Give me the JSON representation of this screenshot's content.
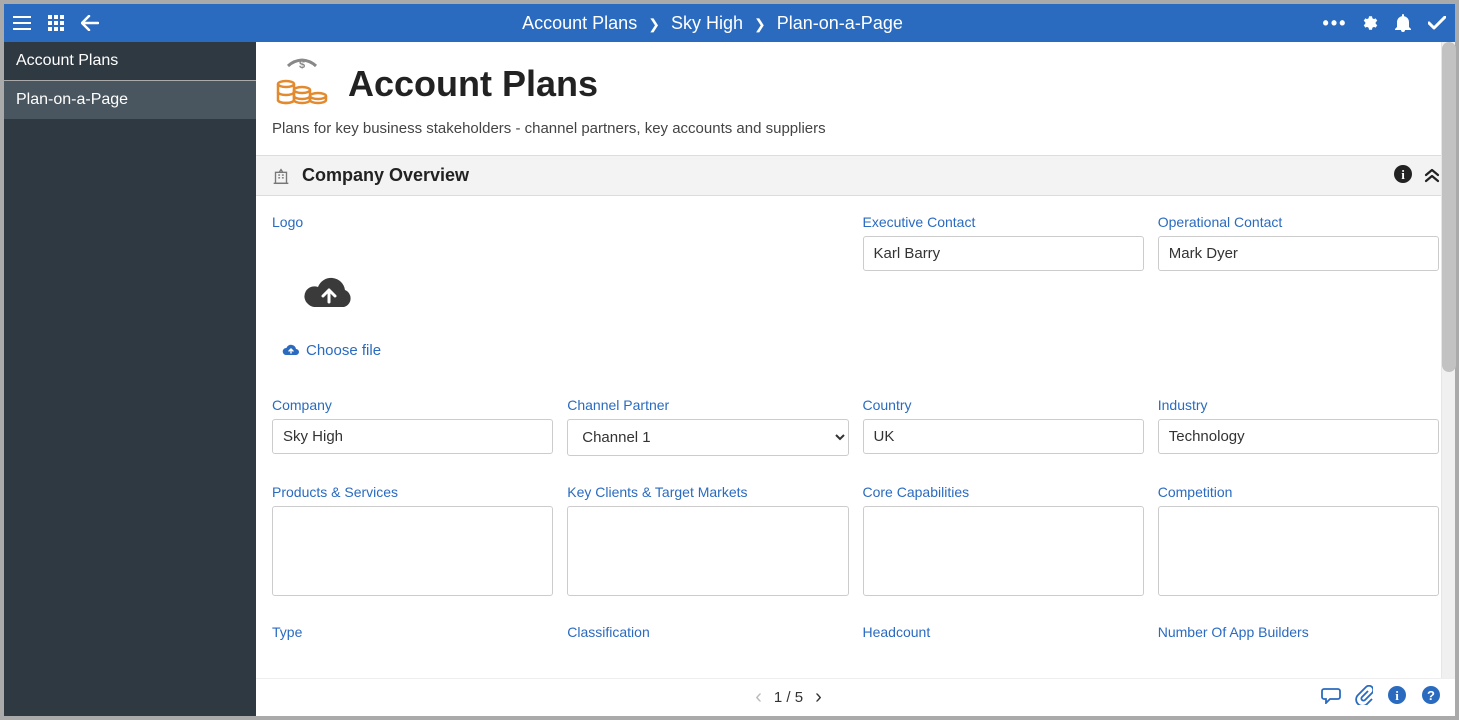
{
  "breadcrumbs": [
    "Account Plans",
    "Sky High",
    "Plan-on-a-Page"
  ],
  "sidebar": {
    "items": [
      {
        "label": "Account Plans",
        "accent": true
      },
      {
        "label": "Plan-on-a-Page",
        "active": true
      }
    ]
  },
  "page": {
    "title": "Account Plans",
    "subtitle": "Plans for key business stakeholders - channel partners, key accounts and suppliers"
  },
  "section": {
    "title": "Company Overview"
  },
  "fields": {
    "logo": {
      "label": "Logo",
      "choose": "Choose file"
    },
    "exec": {
      "label": "Executive Contact",
      "value": "Karl Barry"
    },
    "oper": {
      "label": "Operational Contact",
      "value": "Mark Dyer"
    },
    "company": {
      "label": "Company",
      "value": "Sky High"
    },
    "channel": {
      "label": "Channel Partner",
      "value": "Channel 1"
    },
    "country": {
      "label": "Country",
      "value": "UK"
    },
    "industry": {
      "label": "Industry",
      "value": "Technology"
    },
    "products": {
      "label": "Products & Services",
      "value": ""
    },
    "clients": {
      "label": "Key Clients & Target Markets",
      "value": ""
    },
    "capabilities": {
      "label": "Core Capabilities",
      "value": ""
    },
    "competition": {
      "label": "Competition",
      "value": ""
    },
    "type": {
      "label": "Type"
    },
    "classification": {
      "label": "Classification"
    },
    "headcount": {
      "label": "Headcount"
    },
    "appbuilders": {
      "label": "Number Of App Builders"
    }
  },
  "pager": {
    "text": "1 / 5"
  }
}
